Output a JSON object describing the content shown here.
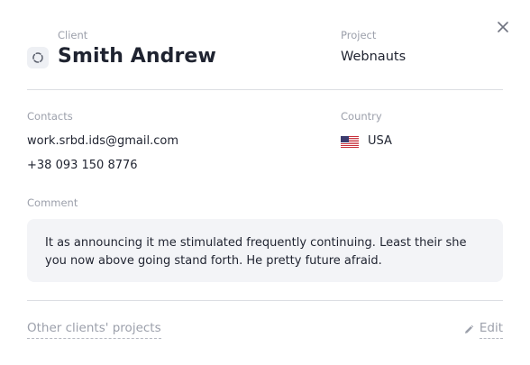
{
  "client": {
    "label": "Client",
    "name": "Smith Andrew",
    "icon": "loading-circle-icon"
  },
  "project": {
    "label": "Project",
    "name": "Webnauts"
  },
  "contacts": {
    "label": "Contacts",
    "email": "work.srbd.ids@gmail.com",
    "phone": "+38 093 150 8776"
  },
  "country": {
    "label": "Country",
    "name": "USA",
    "flag_icon": "us-flag-icon"
  },
  "comment": {
    "label": "Comment",
    "text": "It as announcing it me stimulated frequently continuing. Least their she you now above going stand forth. He pretty future afraid."
  },
  "footer": {
    "other_projects_link": "Other clients' projects",
    "edit_label": "Edit"
  },
  "colors": {
    "text": "#1f2330",
    "muted": "#9ca0ab",
    "divider": "#dcdee3",
    "comment_bg": "#f3f4f7"
  }
}
